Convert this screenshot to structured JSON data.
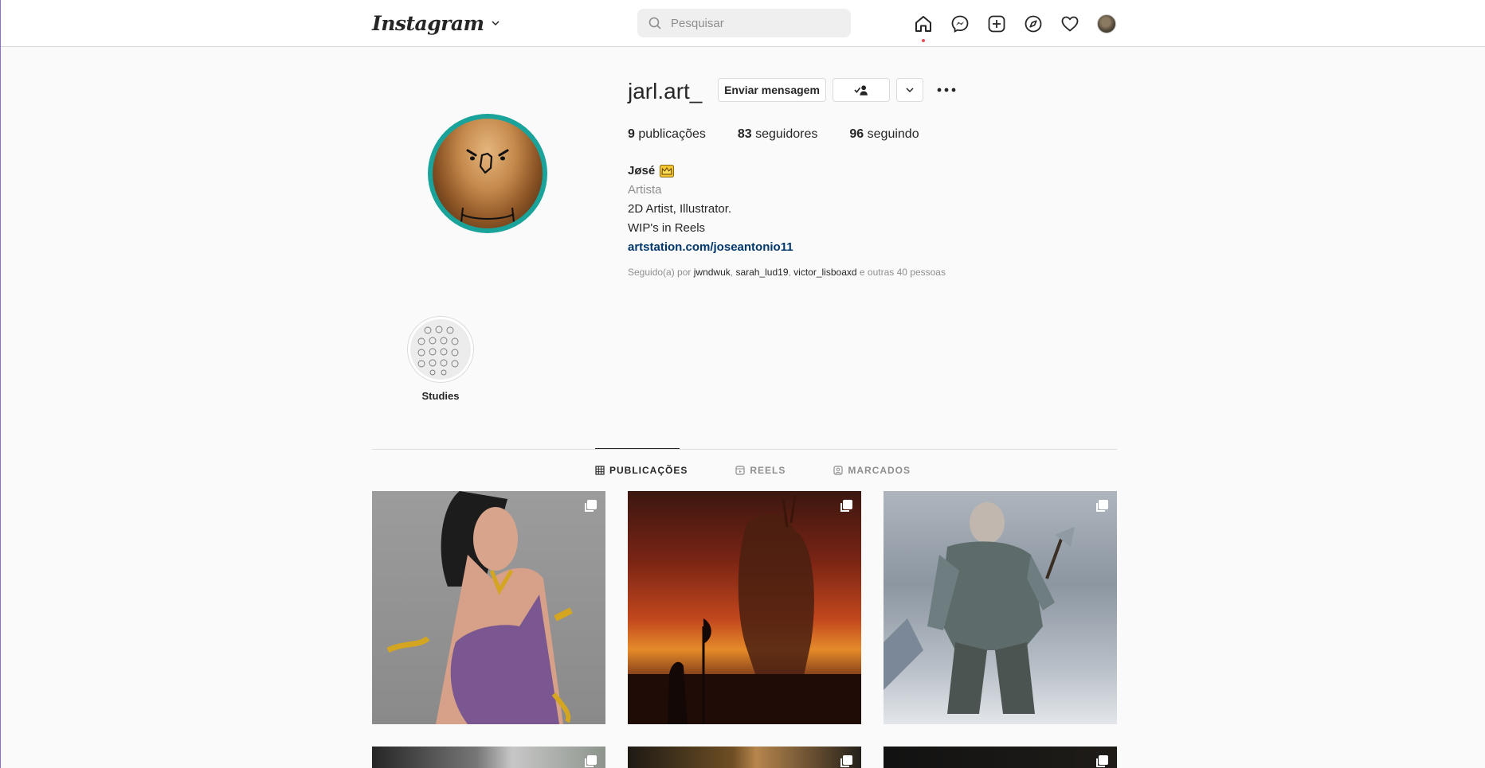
{
  "nav": {
    "logo": "Instagram",
    "search_placeholder": "Pesquisar",
    "icons": [
      "home-icon",
      "messenger-icon",
      "new-post-icon",
      "explore-icon",
      "activity-heart-icon",
      "profile-avatar"
    ]
  },
  "profile": {
    "username": "jarl.art_",
    "message_button": "Enviar mensagem",
    "stats": [
      {
        "count": "9",
        "label": "publicações"
      },
      {
        "count": "83",
        "label": "seguidores"
      },
      {
        "count": "96",
        "label": "seguindo"
      }
    ],
    "name": "Jøsé",
    "category": "Artista",
    "bio_lines": [
      "2D Artist, Illustrator.",
      "WIP's in Reels"
    ],
    "link": "artstation.com/joseantonio11",
    "followed_prefix": "Seguido(a) por",
    "followed_users": [
      "jwndwuk",
      "sarah_lud19",
      "victor_lisboaxd"
    ],
    "followed_suffix": "e outras 40 pessoas"
  },
  "highlights": [
    {
      "label": "Studies"
    }
  ],
  "tabs": [
    {
      "label": "PUBLICAÇÕES",
      "active": true
    },
    {
      "label": "REELS",
      "active": false
    },
    {
      "label": "MARCADOS",
      "active": false
    }
  ],
  "colors": {
    "accent_link": "#00376b",
    "notification_dot": "#ed4956",
    "avatar_ring": "#1aa39a"
  }
}
